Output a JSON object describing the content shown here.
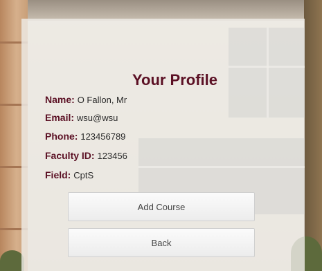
{
  "profile": {
    "title": "Your Profile",
    "fields": [
      {
        "label": "Name:",
        "value": "O Fallon, Mr"
      },
      {
        "label": "Email:",
        "value": "wsu@wsu"
      },
      {
        "label": "Phone:",
        "value": "123456789"
      },
      {
        "label": "Faculty ID:",
        "value": "123456"
      },
      {
        "label": "Field:",
        "value": "CptS"
      }
    ]
  },
  "actions": {
    "add_course_label": "Add Course",
    "back_label": "Back"
  },
  "colors": {
    "accent": "#5b1024",
    "card_background": "#eeebe6"
  }
}
